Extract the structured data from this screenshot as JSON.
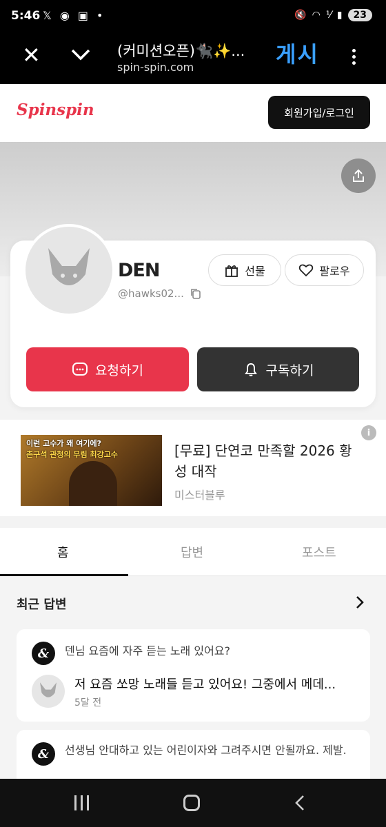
{
  "statusbar": {
    "time": "5:46",
    "notif_icons": [
      "x-logo",
      "discord",
      "screen-capture",
      "dot"
    ],
    "right_icons": [
      "mute",
      "wifi",
      "volte",
      "signal"
    ],
    "battery": "23"
  },
  "browser": {
    "page_title": "(커미션오픈)🐈‍⬛✨...",
    "url": "spin-spin.com",
    "ad_text": "게시"
  },
  "site": {
    "logo": "Spinspin",
    "login_label": "회원가입/로그인"
  },
  "profile": {
    "name": "DEN",
    "handle": "@hawks02...",
    "gift_label": "선물",
    "follow_label": "팔로우",
    "request_label": "요청하기",
    "subscribe_label": "구독하기"
  },
  "ad": {
    "image_caption_1": "이런 고수가 왜 여기에?",
    "image_caption_2": "촌구석 관청의 무림 최강고수",
    "title": "[무료] 단연코 만족할 2026 황성 대작",
    "subtitle": "미스터블루"
  },
  "tabs": [
    {
      "label": "홈",
      "active": true
    },
    {
      "label": "답변",
      "active": false
    },
    {
      "label": "포스트",
      "active": false
    }
  ],
  "recent": {
    "title": "최근 답변",
    "items": [
      {
        "question": "덴님 요즘에 자주 듣는 노래 있어요?",
        "answer": "저 요즘 쏘망 노래들 듣고 있어요! 그중에서 메데...",
        "time": "5달 전"
      },
      {
        "question": "선생님 안대하고 있는 어린이자와 그려주시면 안될까요. 제발."
      }
    ]
  },
  "colors": {
    "brand": "#e8354b",
    "dark_button": "#333333",
    "ad_text": "#3aa0ff"
  }
}
